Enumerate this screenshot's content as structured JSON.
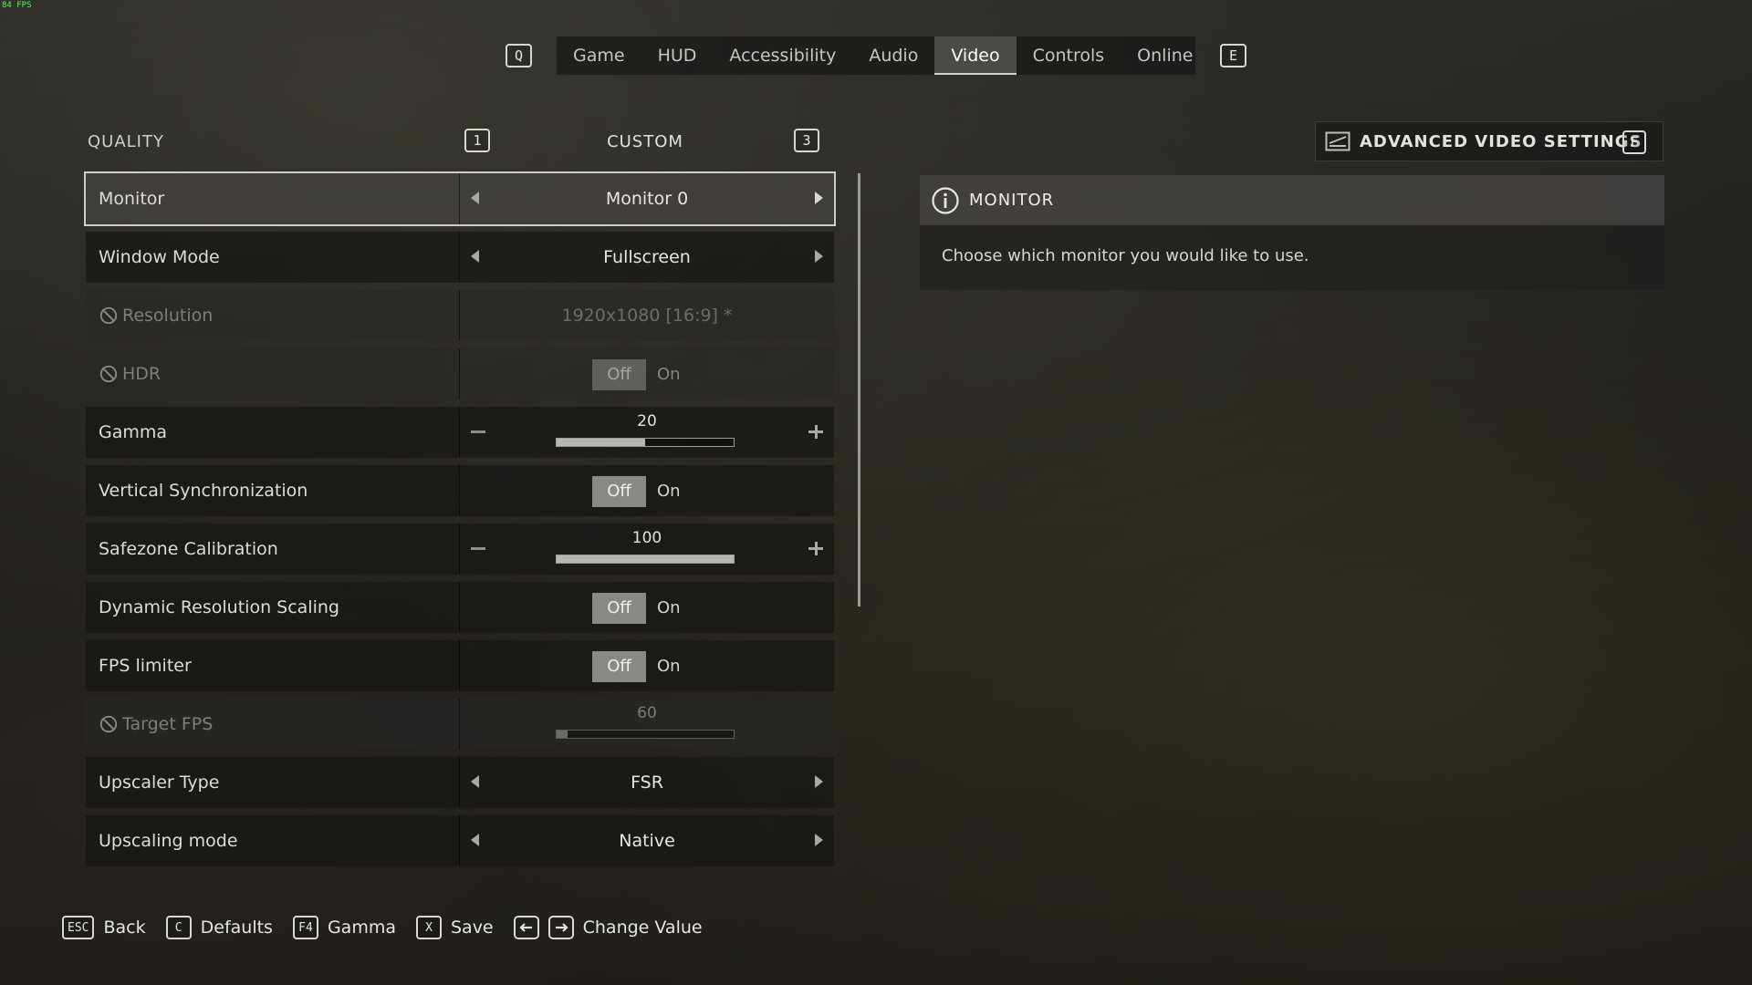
{
  "fps_counter": "84 FPS",
  "tabs": {
    "prev_key": "Q",
    "next_key": "E",
    "items": [
      {
        "label": "Game"
      },
      {
        "label": "HUD"
      },
      {
        "label": "Accessibility"
      },
      {
        "label": "Audio"
      },
      {
        "label": "Video",
        "active": true
      },
      {
        "label": "Controls"
      },
      {
        "label": "Online"
      }
    ]
  },
  "quality": {
    "label": "QUALITY",
    "prev_key": "1",
    "next_key": "3",
    "value": "CUSTOM"
  },
  "settings": [
    {
      "name": "Monitor",
      "type": "selector",
      "value": "Monitor 0",
      "selected": true
    },
    {
      "name": "Window Mode",
      "type": "selector",
      "value": "Fullscreen"
    },
    {
      "name": "Resolution",
      "type": "selector",
      "value": "1920x1080 [16:9] *",
      "disabled": true
    },
    {
      "name": "HDR",
      "type": "toggle",
      "off_label": "Off",
      "on_label": "On",
      "state": "Off",
      "disabled": true
    },
    {
      "name": "Gamma",
      "type": "slider",
      "value": "20",
      "fill_fraction": 0.5
    },
    {
      "name": "Vertical Synchronization",
      "type": "toggle",
      "off_label": "Off",
      "on_label": "On",
      "state": "Off"
    },
    {
      "name": "Safezone Calibration",
      "type": "slider",
      "value": "100",
      "fill_fraction": 1.0
    },
    {
      "name": "Dynamic Resolution Scaling",
      "type": "toggle",
      "off_label": "Off",
      "on_label": "On",
      "state": "Off"
    },
    {
      "name": "FPS limiter",
      "type": "toggle",
      "off_label": "Off",
      "on_label": "On",
      "state": "Off"
    },
    {
      "name": "Target FPS",
      "type": "slider",
      "value": "60",
      "fill_fraction": 0.06,
      "disabled": true
    },
    {
      "name": "Upscaler Type",
      "type": "selector",
      "value": "FSR"
    },
    {
      "name": "Upscaling mode",
      "type": "selector",
      "value": "Native"
    }
  ],
  "advanced": {
    "label": "ADVANCED VIDEO SETTINGS",
    "key": "F"
  },
  "info": {
    "title": "MONITOR",
    "description": "Choose which monitor you would like to use."
  },
  "footer": {
    "back_key": "ESC",
    "back_label": "Back",
    "defaults_key": "C",
    "defaults_label": "Defaults",
    "gamma_key": "F4",
    "gamma_label": "Gamma",
    "save_key": "X",
    "save_label": "Save",
    "change_label": "Change Value"
  }
}
